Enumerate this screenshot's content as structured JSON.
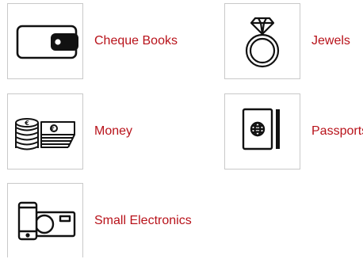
{
  "theme": {
    "label_color": "#b8121a",
    "icon_color": "#111111",
    "border_color": "#c9c9c9"
  },
  "items": [
    {
      "label": "Cheque Books",
      "icon": "wallet-icon"
    },
    {
      "label": "Jewels",
      "icon": "diamond-ring-icon"
    },
    {
      "label": "Money",
      "icon": "coins-and-cash-icon"
    },
    {
      "label": "Passports",
      "icon": "passport-icon"
    },
    {
      "label": "Small Electronics",
      "icon": "phone-and-camera-icon"
    }
  ]
}
